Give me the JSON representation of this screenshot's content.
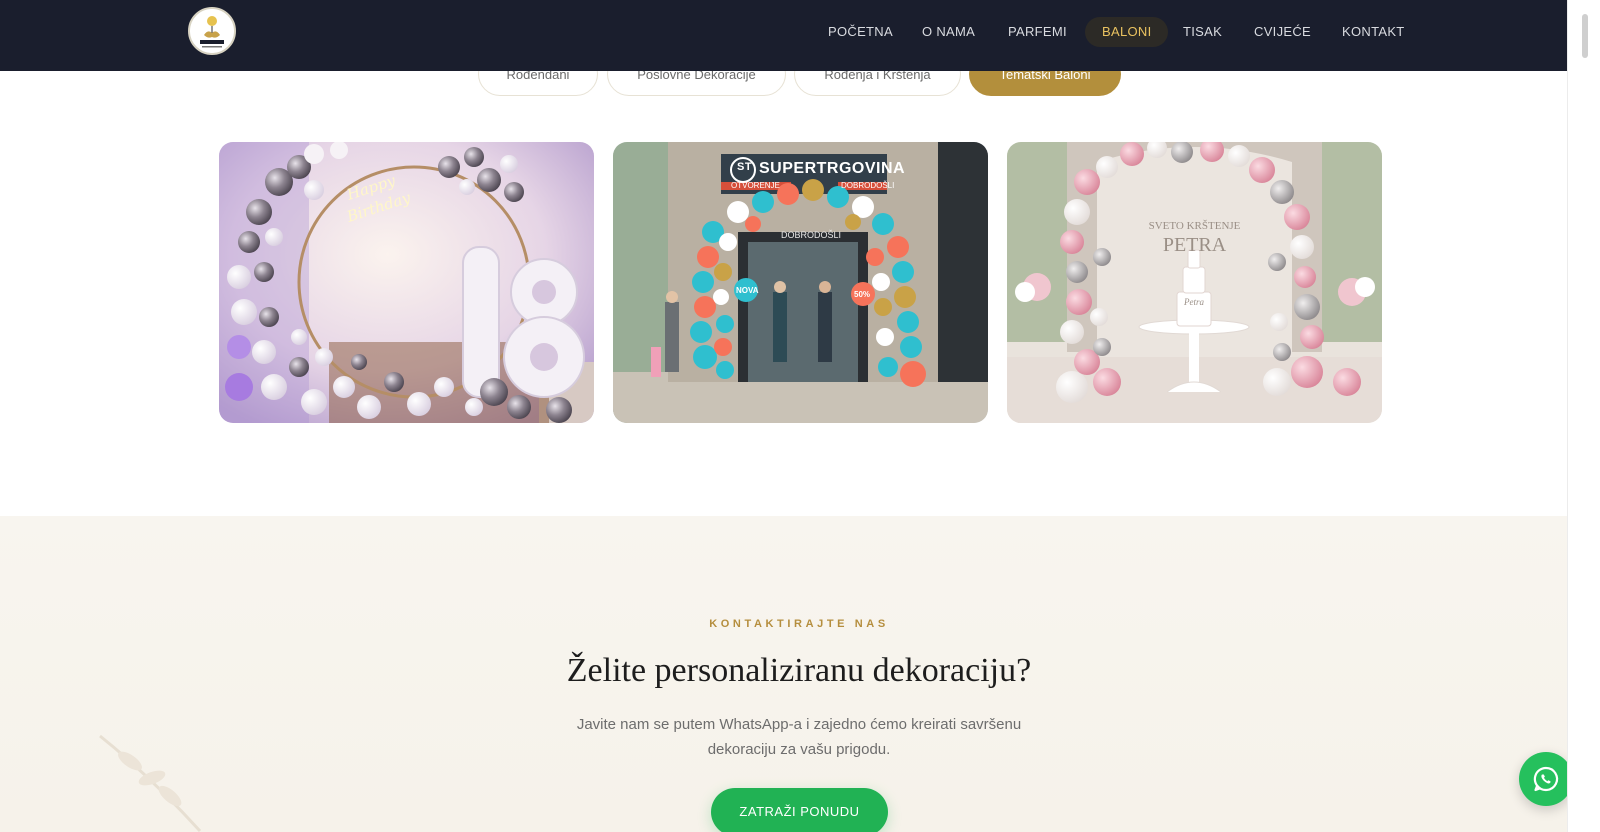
{
  "header": {
    "logo_alt": "DESIGN ART-GI",
    "nav": [
      {
        "label": "POČETNA",
        "active": false
      },
      {
        "label": "O NAMA",
        "active": false
      },
      {
        "label": "PARFEMI",
        "active": false
      },
      {
        "label": "BALONI",
        "active": true
      },
      {
        "label": "TISAK",
        "active": false
      },
      {
        "label": "CVIJEĆE",
        "active": false
      },
      {
        "label": "KONTAKT",
        "active": false
      }
    ]
  },
  "filters": [
    {
      "label": "Rođendani",
      "active": false
    },
    {
      "label": "Poslovne Dekoracije",
      "active": false
    },
    {
      "label": "Rođenja i Krštenja",
      "active": false
    },
    {
      "label": "Tematski Baloni",
      "active": true
    }
  ],
  "gallery": {
    "items": [
      {
        "label": "birthday-18-balloon-arch",
        "neon_text": "Happy Birthday"
      },
      {
        "label": "store-balloon-arch",
        "sign": "SUPERTRGOVINA",
        "sign_badge": "ST",
        "sub_left": "OTVORENJE",
        "sub_right": "DOBRODOŠLI",
        "door_text": "DOBRODOŠLI",
        "tag1": "NOVA",
        "tag2": "50%"
      },
      {
        "label": "christening-balloon-arch",
        "banner_line1": "SVETO KRŠTENJE",
        "banner_line2": "PETRA",
        "cake_text": "Petra"
      }
    ]
  },
  "contact": {
    "eyebrow": "KONTAKTIRAJTE NAS",
    "heading": "Želite personaliziranu dekoraciju?",
    "description": "Javite nam se putem WhatsApp-a i zajedno ćemo kreirati savršenu dekoraciju za vašu prigodu.",
    "cta": "ZATRAŽI PONUDU"
  },
  "colors": {
    "header_bg": "#1a1e2d",
    "accent_gold": "#b38f3c",
    "whatsapp_green": "#25c05d"
  }
}
